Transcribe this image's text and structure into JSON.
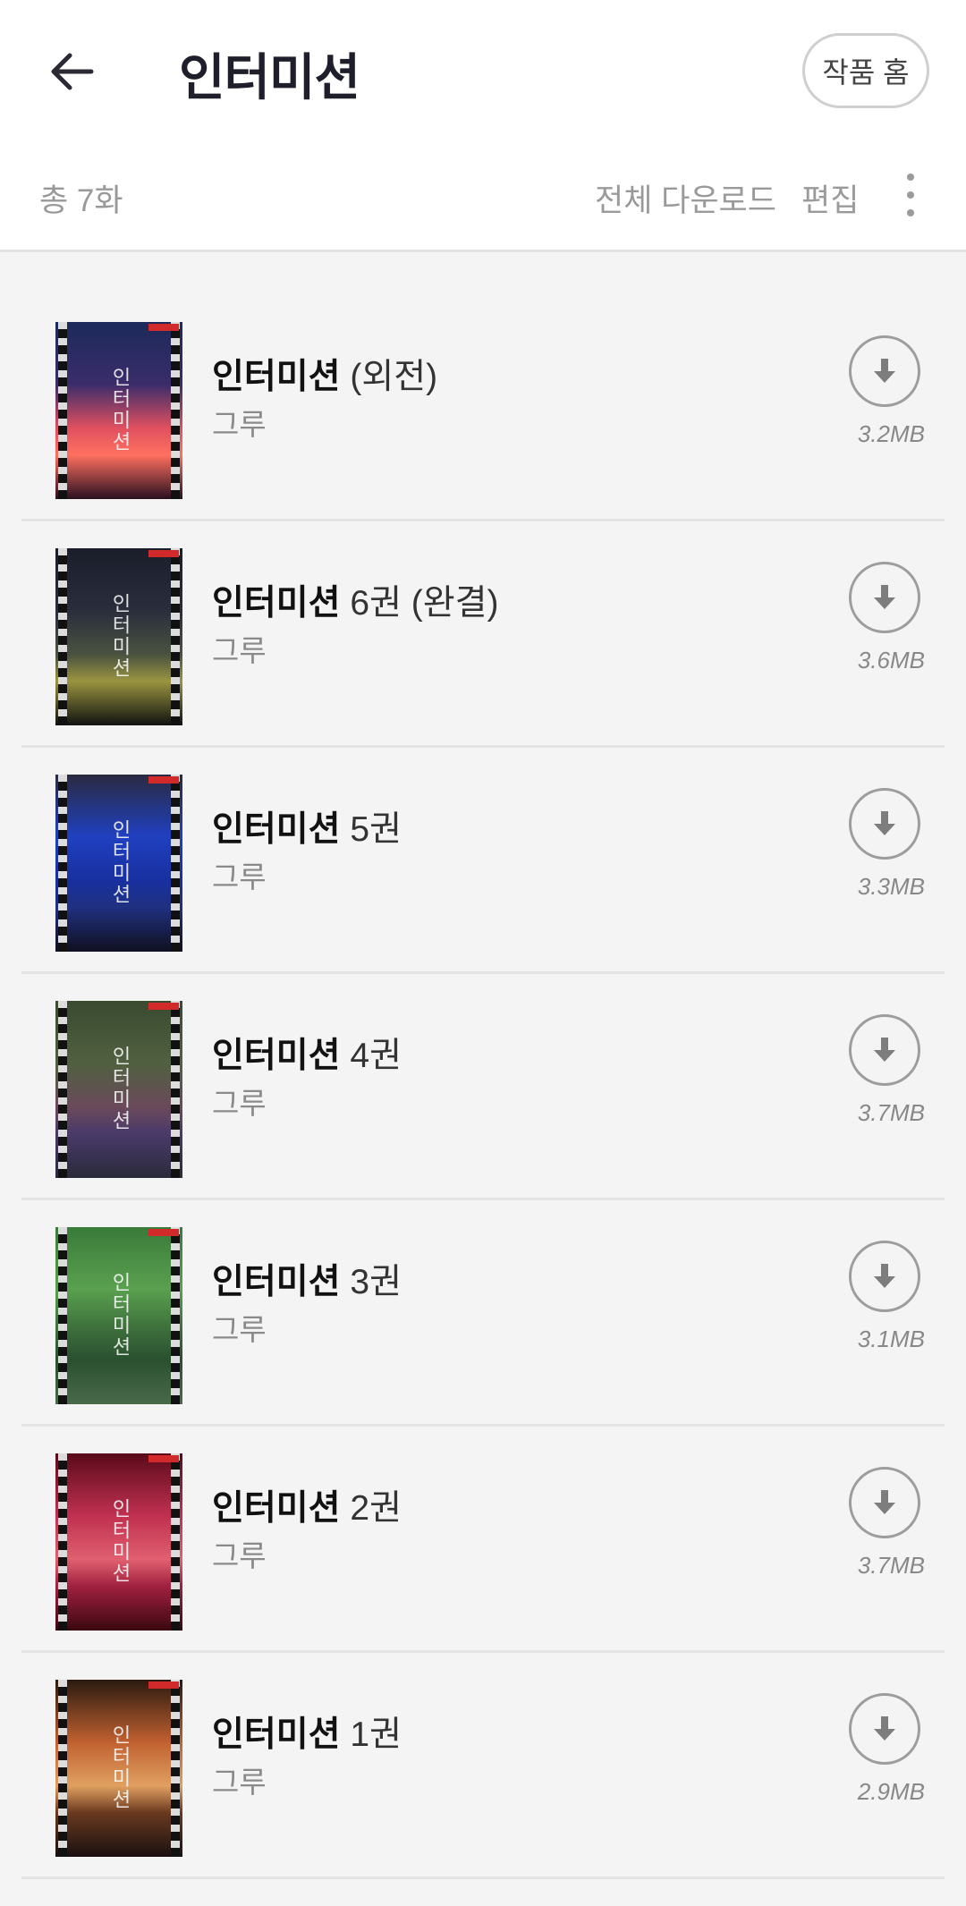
{
  "header": {
    "title": "인터미션",
    "home_label": "작품 홈"
  },
  "toolbar": {
    "total": "총 7화",
    "download_all": "전체 다운로드",
    "edit": "편집"
  },
  "items": [
    {
      "title": "인터미션",
      "suffix": "(외전)",
      "author": "그루",
      "size": "3.2MB",
      "cover_title": "인터미션",
      "cover_colors": [
        "#1c2a5a",
        "#3a2c6a",
        "#e05060",
        "#ff7060",
        "#2a1020"
      ]
    },
    {
      "title": "인터미션",
      "suffix": "6권 (완결)",
      "author": "그루",
      "size": "3.6MB",
      "cover_title": "인터미션",
      "cover_colors": [
        "#1a1d2a",
        "#2a2d3c",
        "#4a5240",
        "#9a9440",
        "#101210"
      ]
    },
    {
      "title": "인터미션",
      "suffix": "5권",
      "author": "그루",
      "size": "3.3MB",
      "cover_title": "인터미션",
      "cover_colors": [
        "#2a2a40",
        "#2040c0",
        "#1830a0",
        "#203080",
        "#101020"
      ]
    },
    {
      "title": "인터미션",
      "suffix": "4권",
      "author": "그루",
      "size": "3.7MB",
      "cover_title": "인터미션",
      "cover_colors": [
        "#3a4a30",
        "#506040",
        "#6a4a5a",
        "#4a3a6a",
        "#2a2a3a"
      ]
    },
    {
      "title": "인터미션",
      "suffix": "3권",
      "author": "그루",
      "size": "3.1MB",
      "cover_title": "인터미션",
      "cover_colors": [
        "#3a7a3a",
        "#5aa050",
        "#3a6a3a",
        "#2a5030",
        "#4a6a4a"
      ]
    },
    {
      "title": "인터미션",
      "suffix": "2권",
      "author": "그루",
      "size": "3.7MB",
      "cover_title": "인터미션",
      "cover_colors": [
        "#5a0a1a",
        "#c03050",
        "#e06070",
        "#a02040",
        "#3a0810"
      ]
    },
    {
      "title": "인터미션",
      "suffix": "1권",
      "author": "그루",
      "size": "2.9MB",
      "cover_title": "인터미션",
      "cover_colors": [
        "#2a1a10",
        "#c06030",
        "#e0a060",
        "#6a3a20",
        "#1a1010"
      ]
    }
  ],
  "colors": {
    "background": "#f4f4f4",
    "header_bg": "#ffffff",
    "title": "#1f1f2b",
    "muted": "#9a9a9a"
  }
}
